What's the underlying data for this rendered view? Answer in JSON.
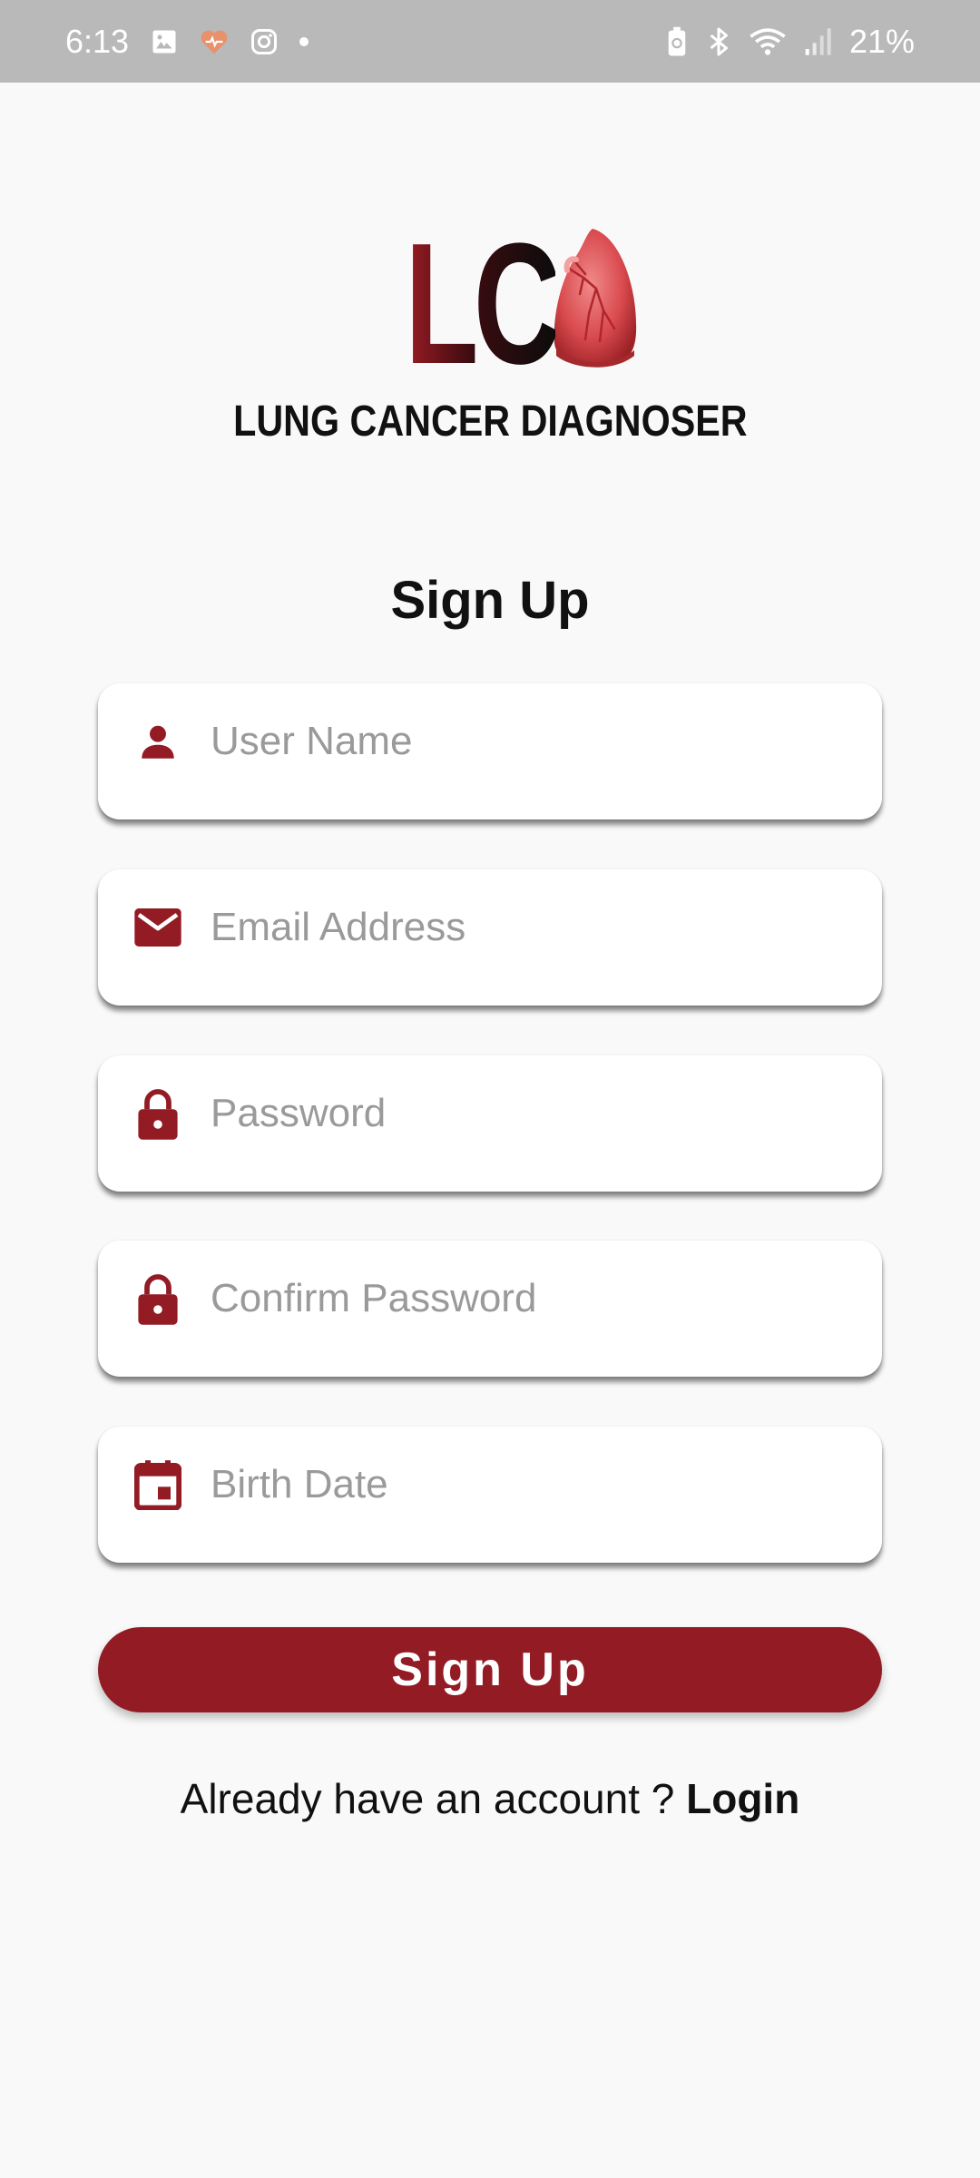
{
  "status_bar": {
    "time": "6:13",
    "battery": "21%",
    "icons_left": [
      "gallery-icon",
      "health-icon",
      "instagram-icon",
      "dot-icon"
    ],
    "icons_right": [
      "battery-saver-icon",
      "bluetooth-icon",
      "wifi-icon",
      "signal-icon"
    ]
  },
  "logo": {
    "letters": "LC",
    "subtitle": "LUNG CANCER DIAGNOSER"
  },
  "form": {
    "title": "Sign Up",
    "fields": [
      {
        "placeholder": "User Name",
        "icon": "person-icon",
        "value": ""
      },
      {
        "placeholder": "Email Address",
        "icon": "mail-icon",
        "value": ""
      },
      {
        "placeholder": "Password",
        "icon": "lock-icon",
        "value": ""
      },
      {
        "placeholder": "Confirm Password",
        "icon": "lock-icon",
        "value": ""
      },
      {
        "placeholder": "Birth Date",
        "icon": "calendar-icon",
        "value": ""
      }
    ],
    "submit_label": "Sign Up",
    "login_prompt": "Already have an account ? ",
    "login_link": "Login"
  },
  "colors": {
    "accent": "#921b24",
    "status_bar": "#b9b9b9",
    "background": "#f9f9f9"
  }
}
